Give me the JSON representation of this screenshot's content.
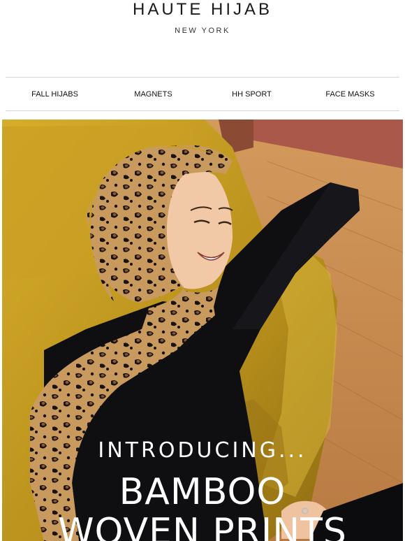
{
  "brand": {
    "name": "HAUTE HIJAB",
    "location": "NEW YORK"
  },
  "nav": {
    "items": [
      {
        "label": "FALL HIJABS"
      },
      {
        "label": "MAGNETS"
      },
      {
        "label": "HH SPORT"
      },
      {
        "label": "FACE MASKS"
      }
    ]
  },
  "hero": {
    "intro": "INTRODUCING...",
    "headline_line1": "BAMBOO",
    "headline_line2": "WOVEN PRINTS",
    "image_subject": "woman in leopard print hijab sitting by mustard velvet armchair"
  },
  "colors": {
    "chair": "#c49a1d",
    "floor": "#c88a4c",
    "wall": "#a9584a",
    "top": "#0f0f12",
    "skin": "#f2c9a6",
    "leopard_base": "#c99a5e",
    "text_white": "#ffffff"
  }
}
